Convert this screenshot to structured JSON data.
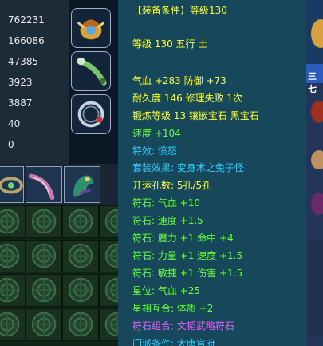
{
  "stats": [
    "762231",
    "166086",
    "47385",
    "3923",
    "3887",
    "40",
    "0"
  ],
  "tooltip": {
    "header": "【装备条件】等级130",
    "level_line": "等级 130 五行 土",
    "hp_def": "气血 +283 防御 +73",
    "durability": "耐久度 146 修理失败 1次",
    "forge": "锻炼等级 13 镶嵌宝石 黑宝石",
    "speed": "速度 +104",
    "special": "特效: 愤怒",
    "set_effect": "套装效果: 变身术之兔子怪",
    "holes": "开运孔数: 5孔/5孔",
    "rune1": "符石: 气血 +10",
    "rune2": "符石: 速度 +1.5",
    "rune3": "符石: 魔力 +1 命中 +4",
    "rune4": "符石: 力量 +1 速度 +1.5",
    "rune5": "符石: 敏捷 +1 伤害 +1.5",
    "star": "星位: 气血 +25",
    "zodiac": "星相互合: 体质 +2",
    "rune_combo": "符石组合: 文韬武略符石",
    "sect_req": "门派条件: 大唐官府"
  },
  "side_label": "三七",
  "colors": {
    "white": "#ffffff",
    "yellow": "#ffff33",
    "green": "#66ff33",
    "blue": "#33ccff",
    "purple": "#e060ff"
  },
  "icons": {
    "equip_slots": [
      "helmet-icon",
      "weapon-icon",
      "necklace-icon"
    ],
    "inventory": [
      "bracelet-icon",
      "ribbon-icon",
      "dragon-figure-icon"
    ],
    "grid_cell": "sealed-slot-icon"
  }
}
